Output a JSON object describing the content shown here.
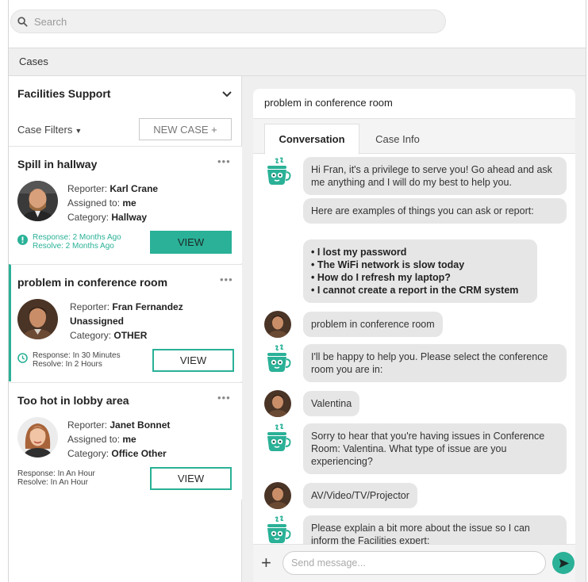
{
  "search": {
    "placeholder": "Search"
  },
  "nav": {
    "section_label": "Cases"
  },
  "sidebar": {
    "group_title": "Facilities Support",
    "filters_label": "Case Filters",
    "new_case_label": "NEW CASE +",
    "view_label": "VIEW",
    "cases": [
      {
        "title": "Spill in hallway",
        "reporter_label": "Reporter:",
        "reporter": "Karl Crane",
        "assigned_label": "Assigned to:",
        "assigned": "me",
        "category_label": "Category:",
        "category": "Hallway",
        "response": "Response: 2 Months Ago",
        "resolve": "Resolve: 2 Months Ago",
        "sla_status": "overdue"
      },
      {
        "title": "problem in conference room",
        "reporter_label": "Reporter:",
        "reporter": "Fran Fernandez",
        "assigned": "Unassigned",
        "category_label": "Category:",
        "category": "OTHER",
        "response": "Response: In 30 Minutes",
        "resolve": "Resolve: In 2 Hours",
        "sla_status": "pending"
      },
      {
        "title": "Too hot in lobby area",
        "reporter_label": "Reporter:",
        "reporter": "Janet Bonnet",
        "assigned_label": "Assigned to:",
        "assigned": "me",
        "category_label": "Category:",
        "category": "Office Other",
        "response": "Response: In An Hour",
        "resolve": "Resolve: In An Hour",
        "sla_status": "normal"
      }
    ]
  },
  "chat": {
    "title": "problem in conference room",
    "tabs": [
      {
        "label": "Conversation",
        "active": true
      },
      {
        "label": "Case Info",
        "active": false
      }
    ],
    "messages": [
      {
        "from": "bot",
        "text": "Hi Fran, it's a privilege to serve you! Go ahead and ask me anything and I will do my best to help you."
      },
      {
        "from": "bot",
        "text": "Here are examples of things you can ask or report:"
      },
      {
        "from": "bot",
        "items": [
          "• I lost my password",
          "• The WiFi network is slow today",
          "• How do I refresh my laptop?",
          "• I cannot create a report in the CRM system"
        ]
      },
      {
        "from": "user",
        "text": "problem in conference room"
      },
      {
        "from": "bot",
        "text": "I'll be happy to help you. Please select the conference room you are in:"
      },
      {
        "from": "user",
        "text": "Valentina"
      },
      {
        "from": "bot",
        "text": "Sorry to hear that you're having issues in Conference Room: Valentina. What type of issue are you experiencing?"
      },
      {
        "from": "user",
        "text": "AV/Video/TV/Projector"
      },
      {
        "from": "bot",
        "text": "Please explain a bit more about the issue so I can inform the Facilities expert:"
      }
    ],
    "composer": {
      "placeholder": "Send message..."
    }
  },
  "colors": {
    "accent": "#2ab197",
    "bubble": "#e6e6e6",
    "panel_bg": "#efefef"
  }
}
